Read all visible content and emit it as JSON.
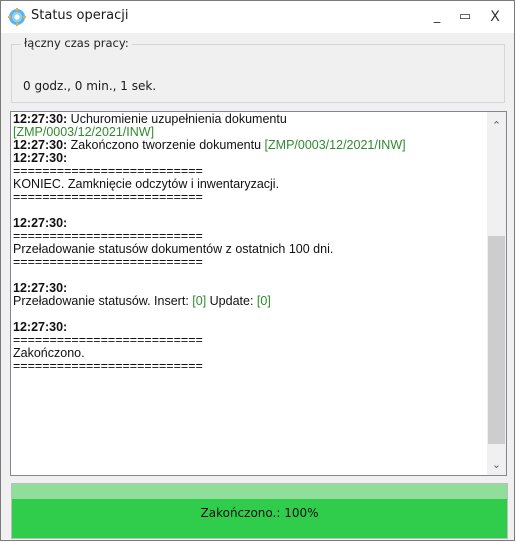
{
  "window": {
    "title": "Status operacji",
    "controls": {
      "minimize": "_",
      "maximize": "▭",
      "close": "X"
    }
  },
  "work_time": {
    "legend": "łączny czas pracy:",
    "value": "0 godz., 0 min., 1 sek."
  },
  "log": {
    "l1": {
      "time": "12:27:30:",
      "text": " Uchuromienie uzupełnienia dokumentu"
    },
    "l2": {
      "doc": "[ZMP/0003/12/2021/INW]"
    },
    "l3": {
      "time": "12:27:30:",
      "text": " Zakończono tworzenie dokumentu ",
      "doc": "[ZMP/0003/12/2021/INW]"
    },
    "l4": {
      "time": "12:27:30:"
    },
    "l5": {
      "text": "=========================="
    },
    "l6": {
      "text": "KONIEC. Zamknięcie odczytów i inwentaryzacji."
    },
    "l7": {
      "text": "=========================="
    },
    "l8": {
      "time": "12:27:30:"
    },
    "l9": {
      "text": "=========================="
    },
    "l10": {
      "text": "Przeładowanie statusów dokumentów z ostatnich 100 dni."
    },
    "l11": {
      "text": "=========================="
    },
    "l12": {
      "time": "12:27:30:"
    },
    "l13": {
      "text": "Przeładowanie statusów. Insert: ",
      "insert": "[0]",
      "mid": " Update: ",
      "update": "[0]"
    },
    "l14": {
      "time": "12:27:30:"
    },
    "l15": {
      "text": "=========================="
    },
    "l16": {
      "text": "Zakończono."
    },
    "l17": {
      "text": "=========================="
    }
  },
  "scrollbar": {
    "up": "⌃",
    "down": "⌄"
  },
  "progress": {
    "label": "Zakończono.: 100%",
    "fraction": 1.0,
    "fill_color": "#2fcd4b"
  }
}
